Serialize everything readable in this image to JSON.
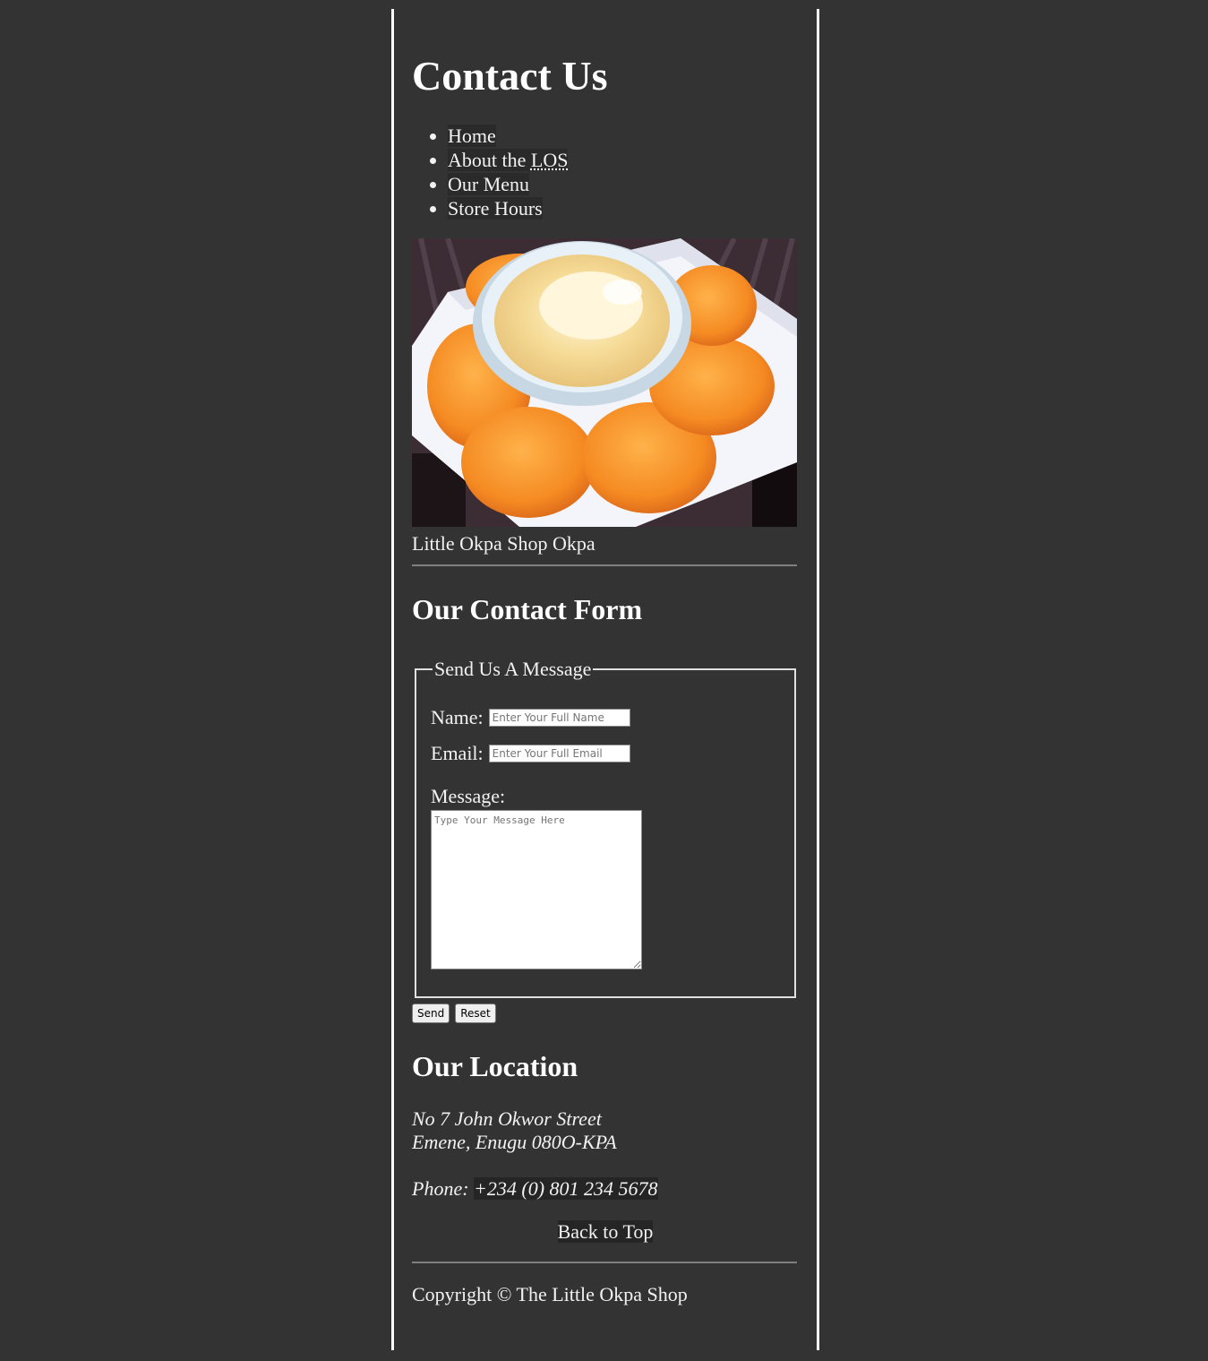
{
  "page_title": "Contact Us",
  "nav": {
    "items": [
      {
        "label": "Home"
      },
      {
        "label_prefix": "About the ",
        "abbr": "LOS"
      },
      {
        "label": "Our Menu"
      },
      {
        "label": "Store Hours"
      }
    ]
  },
  "photo": {
    "caption": "Little Okpa Shop Okpa"
  },
  "contact_form": {
    "title": "Our Contact Form",
    "legend": "Send Us A Message",
    "name_label": "Name:",
    "name_placeholder": "Enter Your Full Name",
    "email_label": "Email:",
    "email_placeholder": "Enter Your Full Email",
    "message_label": "Message:",
    "message_placeholder": "Type Your Message Here",
    "send_label": "Send",
    "reset_label": "Reset"
  },
  "location": {
    "title": "Our Location",
    "address_line1": "No 7 John Okwor Street",
    "address_line2": "Emene, Enugu 080O-KPA",
    "phone_label": "Phone: ",
    "phone_number": "+234 (0) 801 234 5678"
  },
  "back_to_top": "Back to Top",
  "footer": {
    "copyright": "Copyright © The Little Okpa Shop"
  }
}
